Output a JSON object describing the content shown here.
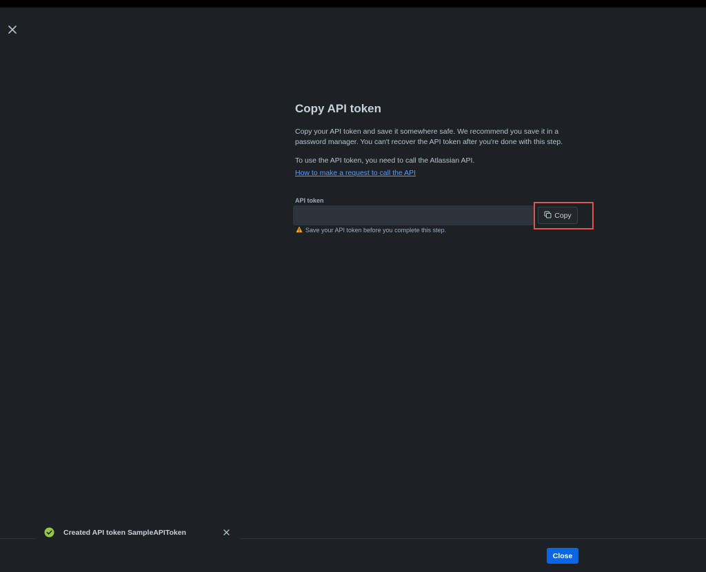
{
  "dialog": {
    "title": "Copy API token",
    "description": "Copy your API token and save it somewhere safe. We recommend you save it in a password manager. You can't recover the API token after you're done with this step.",
    "api_note": "To use the API token, you need to call the Atlassian API.",
    "help_link": "How to make a request to call the API",
    "field_label": "API token",
    "token_value": "",
    "copy_label": "Copy",
    "warning_text": "Save your API token before you complete this step."
  },
  "footer": {
    "close_label": "Close"
  },
  "toast": {
    "message": "Created API token SampleAPIToken"
  },
  "colors": {
    "background": "#1d2125",
    "primary_button": "#0c66e4",
    "link": "#579dff",
    "highlight": "#e5534b",
    "success": "#94c748",
    "warning": "#f5cd47"
  },
  "icons": {
    "window_close": "close-icon",
    "copy": "copy-icon",
    "warning": "warning-icon",
    "success": "check-circle-icon",
    "toast_close": "close-icon"
  }
}
